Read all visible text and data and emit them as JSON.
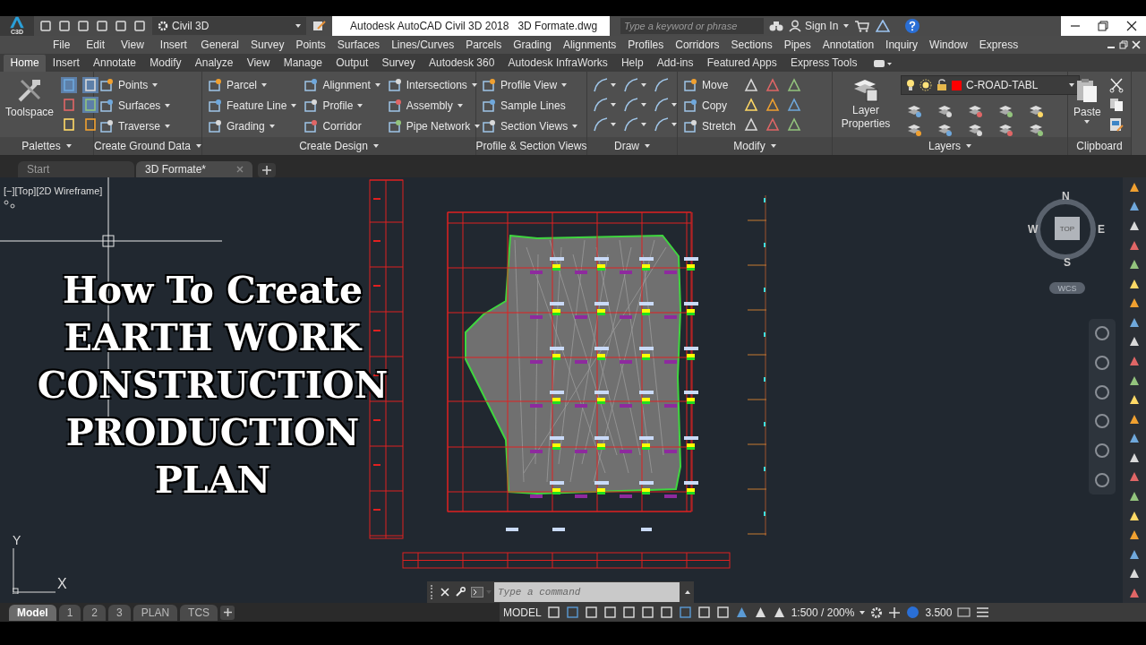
{
  "app_menu": {
    "label": "C3D"
  },
  "quick_access": {
    "workspace": "Civil 3D"
  },
  "window": {
    "title": "Autodesk AutoCAD Civil 3D 2018",
    "file": "3D Formate.dwg"
  },
  "search": {
    "placeholder": "Type a keyword or phrase"
  },
  "account": {
    "label": "Sign In"
  },
  "menu_bar": [
    "File",
    "Edit",
    "View",
    "Insert",
    "General",
    "Survey",
    "Points",
    "Surfaces",
    "Lines/Curves",
    "Parcels",
    "Grading",
    "Alignments",
    "Profiles",
    "Corridors",
    "Sections",
    "Pipes",
    "Annotation",
    "Inquiry",
    "Window",
    "Express"
  ],
  "ribbon_tabs": [
    {
      "label": "Home",
      "selected": true
    },
    {
      "label": "Insert",
      "selected": false
    },
    {
      "label": "Annotate",
      "selected": false
    },
    {
      "label": "Modify",
      "selected": false
    },
    {
      "label": "Analyze",
      "selected": false
    },
    {
      "label": "View",
      "selected": false
    },
    {
      "label": "Manage",
      "selected": false
    },
    {
      "label": "Output",
      "selected": false
    },
    {
      "label": "Survey",
      "selected": false
    },
    {
      "label": "Autodesk 360",
      "selected": false
    },
    {
      "label": "Autodesk InfraWorks",
      "selected": false
    },
    {
      "label": "Help",
      "selected": false
    },
    {
      "label": "Add-ins",
      "selected": false
    },
    {
      "label": "Featured Apps",
      "selected": false
    },
    {
      "label": "Express Tools",
      "selected": false
    }
  ],
  "panels": [
    {
      "title": "Palettes",
      "dropdown": true,
      "kind": "palettes",
      "big": "Toolspace"
    },
    {
      "title": "Create Ground Data",
      "dropdown": true,
      "kind": "list",
      "columns": [
        [
          {
            "label": "Points",
            "dropdown": true
          },
          {
            "label": "Surfaces",
            "dropdown": true
          },
          {
            "label": "Traverse",
            "dropdown": true
          }
        ]
      ]
    },
    {
      "title": "Create Design",
      "dropdown": true,
      "kind": "list",
      "columns": [
        [
          {
            "label": "Parcel",
            "dropdown": true
          },
          {
            "label": "Feature Line",
            "dropdown": true
          },
          {
            "label": "Grading",
            "dropdown": true
          }
        ],
        [
          {
            "label": "Alignment",
            "dropdown": true
          },
          {
            "label": "Profile",
            "dropdown": true
          },
          {
            "label": "Corridor",
            "dropdown": false
          }
        ],
        [
          {
            "label": "Intersections",
            "dropdown": true
          },
          {
            "label": "Assembly",
            "dropdown": true
          },
          {
            "label": "Pipe Network",
            "dropdown": true
          }
        ]
      ]
    },
    {
      "title": "Profile & Section Views",
      "dropdown": false,
      "kind": "list",
      "columns": [
        [
          {
            "label": "Profile View",
            "dropdown": true
          },
          {
            "label": "Sample Lines",
            "dropdown": false
          },
          {
            "label": "Section Views",
            "dropdown": true
          }
        ]
      ]
    },
    {
      "title": "Draw",
      "dropdown": true,
      "kind": "icons"
    },
    {
      "title": "Modify",
      "dropdown": true,
      "kind": "modify",
      "columns": [
        [
          {
            "label": "Move",
            "dropdown": false
          },
          {
            "label": "Copy",
            "dropdown": false
          },
          {
            "label": "Stretch",
            "dropdown": false
          }
        ]
      ]
    },
    {
      "title": "Layers",
      "dropdown": true,
      "kind": "layers",
      "big": "Layer Properties",
      "layer": "C-ROAD-TABL"
    },
    {
      "title": "Clipboard",
      "dropdown": false,
      "kind": "clipboard",
      "big": "Paste"
    }
  ],
  "doc_tabs": [
    {
      "label": "Start",
      "selected": false
    },
    {
      "label": "3D Formate*",
      "selected": true
    }
  ],
  "viewport": {
    "controls": "[−][Top][2D Wireframe]"
  },
  "overlay_title": [
    "How To Create",
    "EARTH WORK",
    "CONSTRUCTION",
    "PRODUCTION",
    "PLAN"
  ],
  "viewcube": {
    "face": "TOP",
    "north": "N",
    "south": "S",
    "east": "E",
    "west": "W",
    "ucs": "WCS"
  },
  "ucs_icon": {
    "x": "X",
    "y": "Y"
  },
  "command_line": {
    "placeholder": "Type a command"
  },
  "layout_tabs": [
    {
      "label": "Model",
      "selected": true
    },
    {
      "label": "1",
      "selected": false
    },
    {
      "label": "2",
      "selected": false
    },
    {
      "label": "3",
      "selected": false
    },
    {
      "label": "PLAN",
      "selected": false
    },
    {
      "label": "TCS",
      "selected": false
    }
  ],
  "status_bar": {
    "space": "MODEL",
    "scale": "1:500 / 200%",
    "value": "3.500"
  }
}
